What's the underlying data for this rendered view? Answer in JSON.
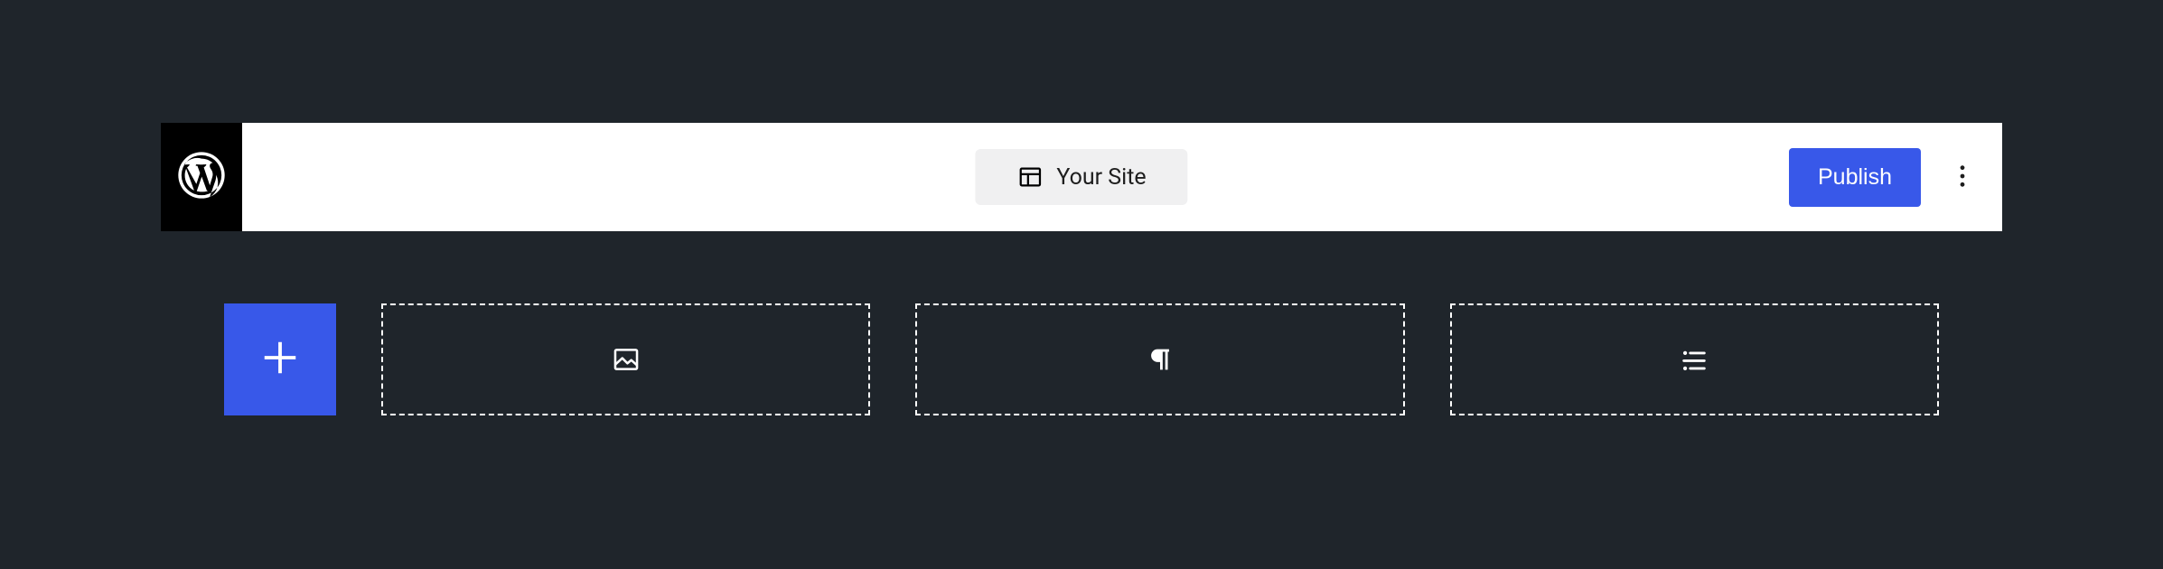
{
  "colors": {
    "bg": "#1f252b",
    "surface": "#ffffff",
    "accent": "#3858e9",
    "pill_bg": "#f0f0f1",
    "logo_bg": "#000000"
  },
  "header": {
    "logo_icon": "wordpress-icon",
    "site_title_icon": "layout-icon",
    "site_title": "Your Site",
    "publish_label": "Publish",
    "more_icon": "kebab-menu-icon"
  },
  "inserter": {
    "add_icon": "plus-icon"
  },
  "blocks": [
    {
      "icon": "image-icon"
    },
    {
      "icon": "paragraph-icon"
    },
    {
      "icon": "list-icon"
    }
  ]
}
